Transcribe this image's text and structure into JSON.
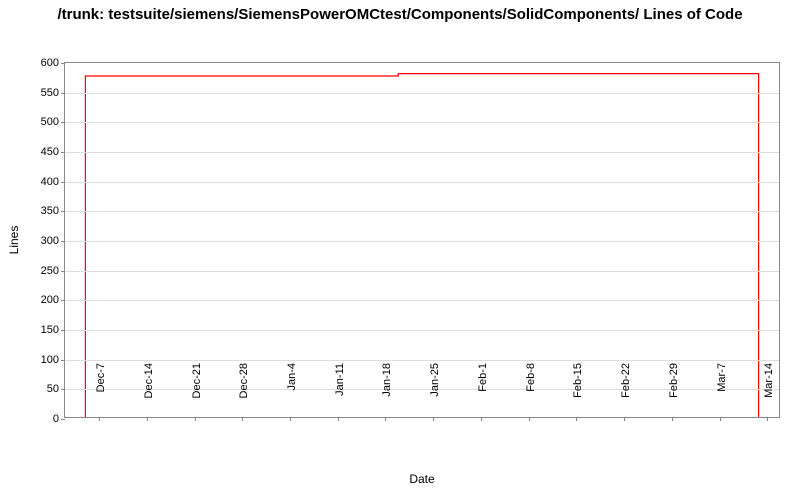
{
  "chart_data": {
    "type": "line",
    "title": "/trunk: testsuite/siemens/SiemensPowerOMCtest/Components/SolidComponents/ Lines of Code",
    "xlabel": "Date",
    "ylabel": "Lines",
    "ylim": [
      0,
      600
    ],
    "y_ticks": [
      0,
      50,
      100,
      150,
      200,
      250,
      300,
      350,
      400,
      450,
      500,
      550,
      600
    ],
    "x_categories": [
      "7-Dec",
      "14-Dec",
      "21-Dec",
      "28-Dec",
      "4-Jan",
      "11-Jan",
      "18-Jan",
      "25-Jan",
      "1-Feb",
      "8-Feb",
      "15-Feb",
      "22-Feb",
      "29-Feb",
      "7-Mar",
      "14-Mar"
    ],
    "series": [
      {
        "name": "Lines of Code",
        "color": "#ff0000",
        "points": [
          {
            "x": "5-Dec",
            "y": 0
          },
          {
            "x": "5-Dec",
            "y": 578
          },
          {
            "x": "20-Jan",
            "y": 578
          },
          {
            "x": "20-Jan",
            "y": 582
          },
          {
            "x": "13-Mar",
            "y": 582
          },
          {
            "x": "13-Mar",
            "y": 0
          }
        ]
      }
    ],
    "x_domain_days": {
      "start": 0,
      "end": 105,
      "first_tick_offset": 5,
      "tick_step": 7
    }
  }
}
